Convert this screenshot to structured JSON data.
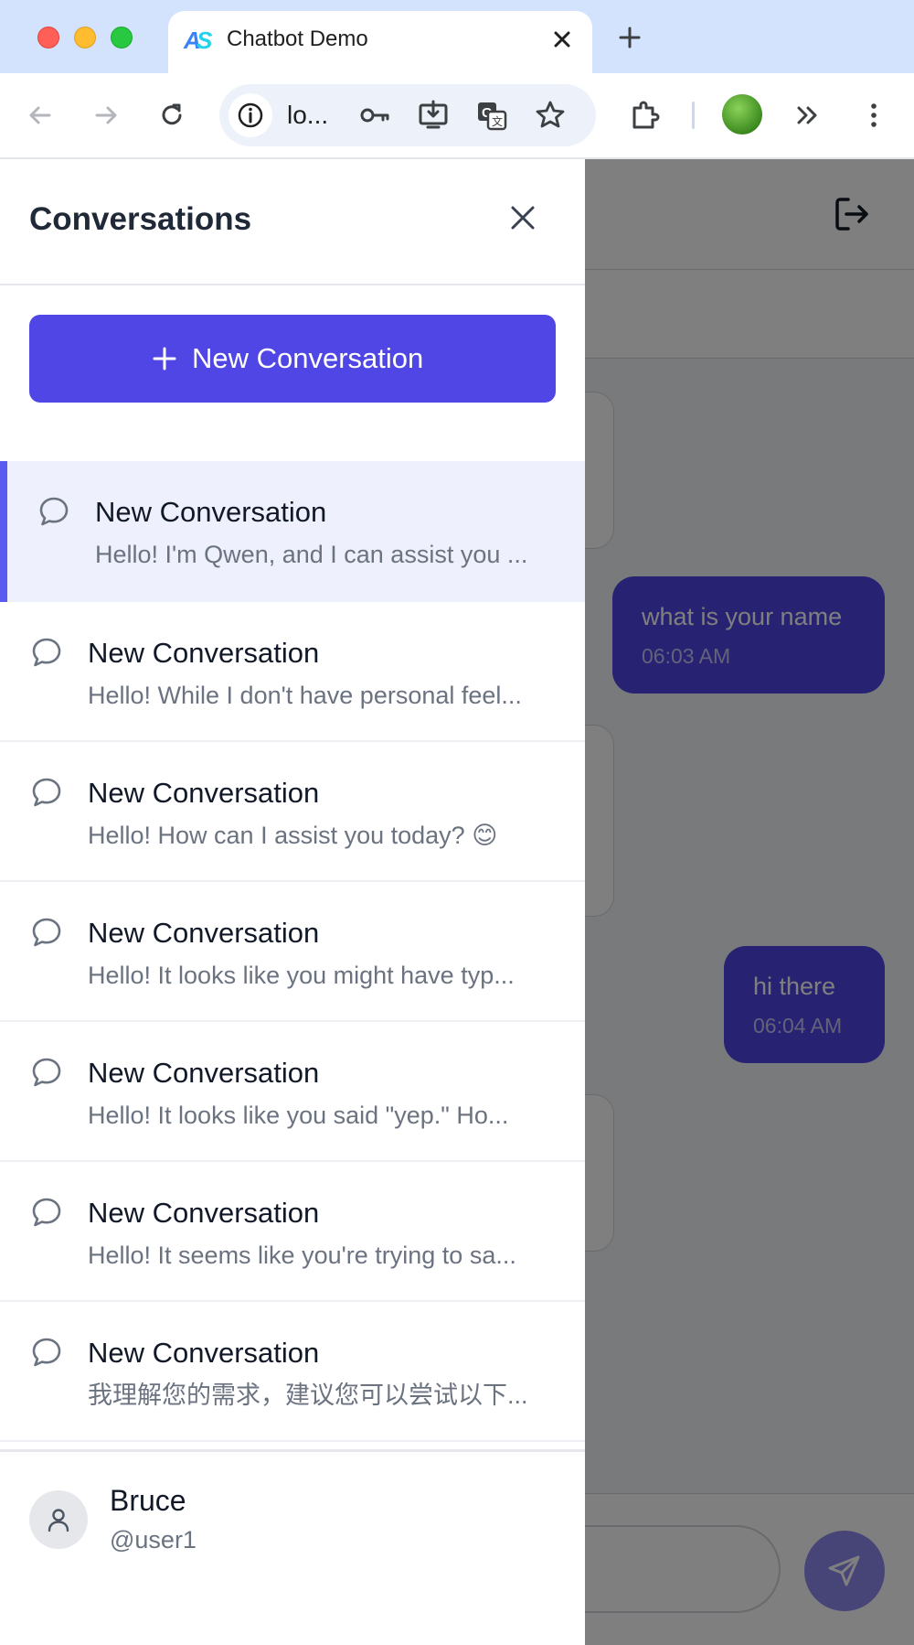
{
  "browser": {
    "tab_title": "Chatbot Demo",
    "url": "lo..."
  },
  "sidebar": {
    "title": "Conversations",
    "new_button_label": "New Conversation",
    "conversations": [
      {
        "title": "New Conversation",
        "preview": "Hello! I'm Qwen, and I can assist you ...",
        "active": true
      },
      {
        "title": "New Conversation",
        "preview": "Hello! While I don't have personal feel...",
        "active": false
      },
      {
        "title": "New Conversation",
        "preview": "Hello! How can I assist you today? 😊",
        "active": false
      },
      {
        "title": "New Conversation",
        "preview": "Hello! It looks like you might have typ...",
        "active": false
      },
      {
        "title": "New Conversation",
        "preview": "Hello! It looks like you said \"yep.\" Ho...",
        "active": false
      },
      {
        "title": "New Conversation",
        "preview": "Hello! It seems like you're trying to sa...",
        "active": false
      },
      {
        "title": "New Conversation",
        "preview": "我理解您的需求，建议您可以尝试以下...",
        "active": false
      }
    ],
    "user": {
      "name": "Bruce",
      "handle": "@user1"
    }
  },
  "chat": {
    "messages": [
      {
        "text": "what is your name",
        "time": "06:03 AM"
      },
      {
        "text": "hi there",
        "time": "06:04 AM"
      }
    ]
  },
  "colors": {
    "accent": "#4f46e5",
    "active_item_bg": "#eef1fd",
    "active_item_bar": "#5b5bf0"
  }
}
